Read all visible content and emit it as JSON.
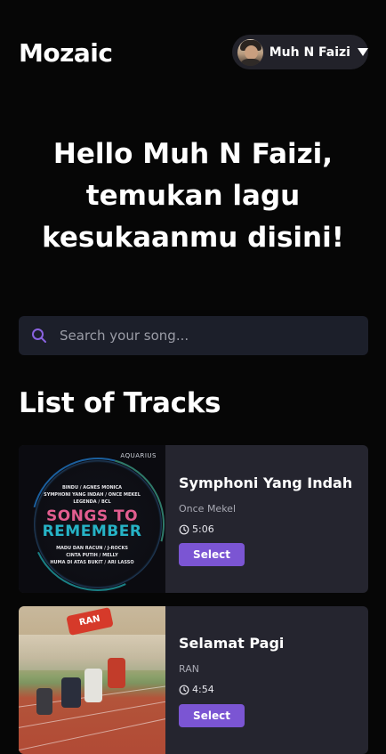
{
  "app": {
    "logo": "Mozaic"
  },
  "user": {
    "name": "Muh N Faizi",
    "avatar_icon": "user-avatar",
    "dropdown_icon": "caret-down-icon"
  },
  "hero": {
    "greeting": "Hello Muh N Faizi, temukan lagu kesukaanmu disini!"
  },
  "search": {
    "placeholder": "Search your song...",
    "value": "",
    "icon": "search-icon"
  },
  "tracks_section": {
    "title": "List of Tracks"
  },
  "tracks": [
    {
      "title": "Symphoni Yang Indah",
      "artist": "Once Mekel",
      "duration": "5:06",
      "select_label": "Select",
      "cover": {
        "label": "AQUARIUS",
        "songs_top": "BINDU / AGNES MONICA\nSYMPHONI YANG INDAH / ONCE MEKEL\nLEGENDA / BCL",
        "headline_1": "SONGS TO",
        "headline_2": "REMEMBER",
        "songs_bottom": "MADU DAN RACUN / J-ROCKS\nCINTA PUTIH / MELLY\nHUMA DI ATAS BUKIT / ARI LASSO"
      }
    },
    {
      "title": "Selamat Pagi",
      "artist": "RAN",
      "duration": "4:54",
      "select_label": "Select",
      "cover": {
        "sign": "RAN"
      }
    }
  ],
  "colors": {
    "background": "#060606",
    "card": "#25252f",
    "search_bg": "#1c1f2a",
    "accent": "#7b55d3",
    "pill": "#22222a"
  }
}
